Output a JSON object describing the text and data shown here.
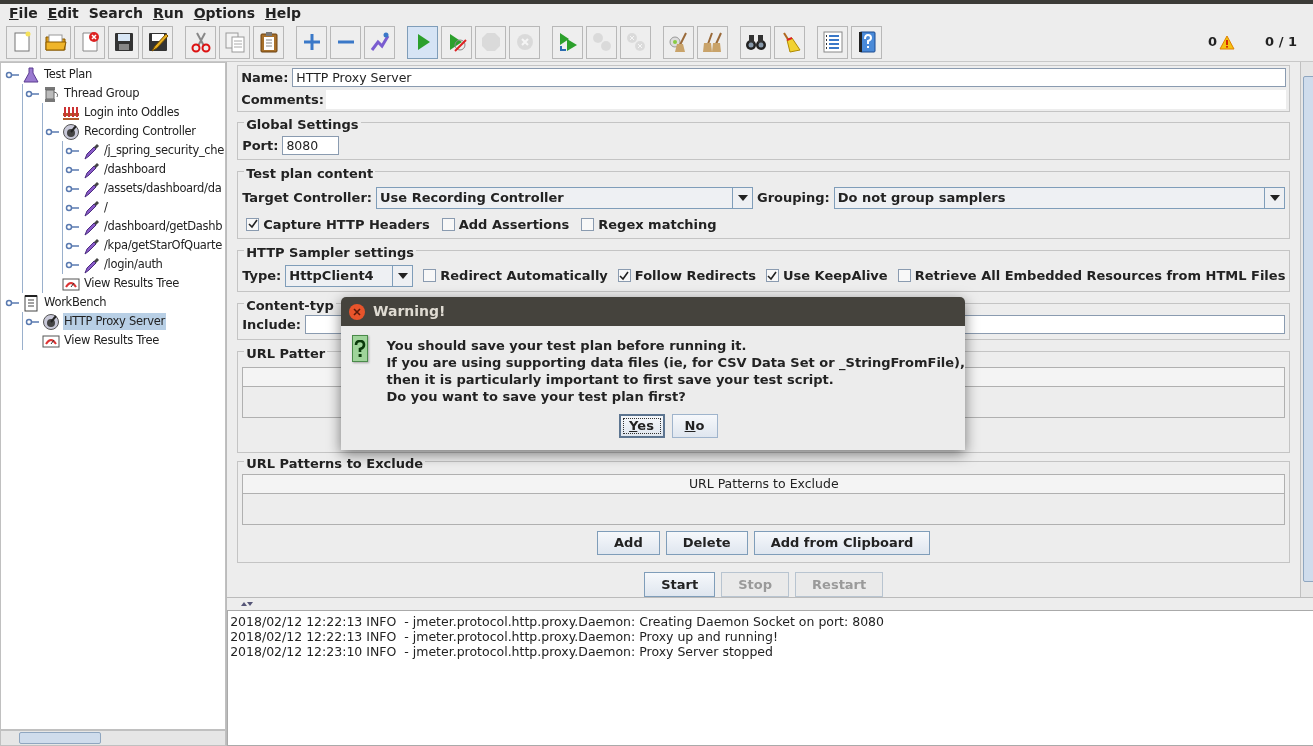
{
  "menu": [
    {
      "label": "File",
      "underlined": true
    },
    {
      "label": "Edit",
      "underlined": true
    },
    {
      "label": "Search",
      "underlined": false
    },
    {
      "label": "Run",
      "underlined": true
    },
    {
      "label": "Options",
      "underlined": true
    },
    {
      "label": "Help",
      "underlined": true
    }
  ],
  "toolbar": [
    [
      {
        "kind": "new",
        "disabled": false,
        "highlighted": false
      },
      {
        "kind": "open",
        "disabled": false,
        "highlighted": false
      },
      {
        "kind": "close",
        "disabled": false,
        "highlighted": false
      },
      {
        "kind": "save",
        "disabled": false,
        "highlighted": false
      },
      {
        "kind": "save-as",
        "disabled": false,
        "highlighted": false
      }
    ],
    [
      {
        "kind": "cut",
        "disabled": false,
        "highlighted": false
      },
      {
        "kind": "copy",
        "disabled": false,
        "highlighted": false
      },
      {
        "kind": "paste",
        "disabled": false,
        "highlighted": false
      }
    ],
    [
      {
        "kind": "expand",
        "disabled": false,
        "highlighted": false
      },
      {
        "kind": "collapse",
        "disabled": false,
        "highlighted": false
      },
      {
        "kind": "toggle",
        "disabled": false,
        "highlighted": false
      }
    ],
    [
      {
        "kind": "start",
        "disabled": false,
        "highlighted": true
      },
      {
        "kind": "start-no-timers",
        "disabled": false,
        "highlighted": false
      },
      {
        "kind": "stop",
        "disabled": true,
        "highlighted": false
      },
      {
        "kind": "shutdown",
        "disabled": true,
        "highlighted": false
      }
    ],
    [
      {
        "kind": "remote-start",
        "disabled": false,
        "highlighted": false
      },
      {
        "kind": "remote-stop",
        "disabled": true,
        "highlighted": false
      },
      {
        "kind": "remote-exit",
        "disabled": true,
        "highlighted": false
      }
    ],
    [
      {
        "kind": "clear",
        "disabled": false,
        "highlighted": false
      },
      {
        "kind": "clear-all",
        "disabled": false,
        "highlighted": false
      }
    ],
    [
      {
        "kind": "search",
        "disabled": false,
        "highlighted": false
      },
      {
        "kind": "reset-search",
        "disabled": false,
        "highlighted": false
      }
    ],
    [
      {
        "kind": "function-helper",
        "disabled": false,
        "highlighted": false
      },
      {
        "kind": "help",
        "disabled": false,
        "highlighted": false
      }
    ]
  ],
  "status": {
    "error_count": "0",
    "threads": "0 / 1"
  },
  "tree": [
    {
      "label": "Test Plan",
      "kind": "flask",
      "selected": false,
      "expandable": true,
      "children": [
        {
          "label": "Thread Group",
          "kind": "spool",
          "selected": false,
          "expandable": true,
          "children": [
            {
              "label": "Login into Oddles",
              "kind": "config",
              "selected": false,
              "expandable": false
            },
            {
              "label": "Recording Controller",
              "kind": "controller",
              "selected": false,
              "expandable": true,
              "children": [
                {
                  "label": "/j_spring_security_che",
                  "kind": "pipette",
                  "selected": false,
                  "expandable": true
                },
                {
                  "label": "/dashboard",
                  "kind": "pipette",
                  "selected": false,
                  "expandable": true
                },
                {
                  "label": "/assets/dashboard/da",
                  "kind": "pipette",
                  "selected": false,
                  "expandable": true
                },
                {
                  "label": "/",
                  "kind": "pipette",
                  "selected": false,
                  "expandable": true
                },
                {
                  "label": "/dashboard/getDashb",
                  "kind": "pipette",
                  "selected": false,
                  "expandable": true
                },
                {
                  "label": "/kpa/getStarOfQuarte",
                  "kind": "pipette",
                  "selected": false,
                  "expandable": true
                },
                {
                  "label": "/login/auth",
                  "kind": "pipette",
                  "selected": false,
                  "expandable": true
                }
              ]
            },
            {
              "label": "View Results Tree",
              "kind": "listener",
              "selected": false,
              "expandable": false
            }
          ]
        }
      ]
    },
    {
      "label": "WorkBench",
      "kind": "clipboard",
      "selected": false,
      "expandable": true,
      "children": [
        {
          "label": "HTTP Proxy Server",
          "kind": "controller",
          "selected": true,
          "expandable": true
        },
        {
          "label": "View Results Tree",
          "kind": "listener",
          "selected": false,
          "expandable": false
        }
      ]
    }
  ],
  "form": {
    "name_label": "Name:",
    "name_value": "HTTP Proxy Server",
    "comments_label": "Comments:",
    "global": {
      "title": "Global Settings",
      "port_label": "Port:",
      "port_value": "8080"
    },
    "content": {
      "title": "Test plan content",
      "target_label": "Target Controller:",
      "target_value": "Use Recording Controller",
      "grouping_label": "Grouping:",
      "grouping_value": "Do not group samplers",
      "options": [
        {
          "label": "Capture HTTP Headers",
          "checked": true
        },
        {
          "label": "Add Assertions",
          "checked": false
        },
        {
          "label": "Regex matching",
          "checked": false
        }
      ]
    },
    "sampler": {
      "title": "HTTP Sampler settings",
      "type_label": "Type:",
      "type_value": "HttpClient4",
      "options": [
        {
          "label": "Redirect Automatically",
          "checked": false
        },
        {
          "label": "Follow Redirects",
          "checked": true
        },
        {
          "label": "Use KeepAlive",
          "checked": true
        },
        {
          "label": "Retrieve All Embedded Resources from HTML Files",
          "checked": false
        }
      ]
    },
    "content_type": {
      "title": "Content-typ",
      "include_label": "Include:"
    },
    "include_patterns": {
      "title": "URL Patter"
    },
    "exclude_patterns": {
      "title": "URL Patterns to Exclude",
      "column": "URL Patterns to Exclude",
      "buttons": [
        "Add",
        "Delete",
        "Add from Clipboard"
      ]
    },
    "actions": [
      {
        "label": "Start",
        "disabled": false
      },
      {
        "label": "Stop",
        "disabled": true
      },
      {
        "label": "Restart",
        "disabled": true
      }
    ]
  },
  "log": [
    "2018/02/12 12:22:13 INFO  - jmeter.protocol.http.proxy.Daemon: Creating Daemon Socket on port: 8080",
    "2018/02/12 12:22:13 INFO  - jmeter.protocol.http.proxy.Daemon: Proxy up and running!",
    "2018/02/12 12:23:10 INFO  - jmeter.protocol.http.proxy.Daemon: Proxy Server stopped"
  ],
  "dialog": {
    "title": "Warning!",
    "lines": [
      "You should save your test plan before running it.",
      "If you are using supporting data files (ie, for CSV Data Set or _StringFromFile),",
      "then it is particularly important to first save your test script.",
      "Do you want to save your test plan first?"
    ],
    "buttons": [
      {
        "label": "Yes",
        "focused": true
      },
      {
        "label": "No",
        "focused": false
      }
    ]
  }
}
